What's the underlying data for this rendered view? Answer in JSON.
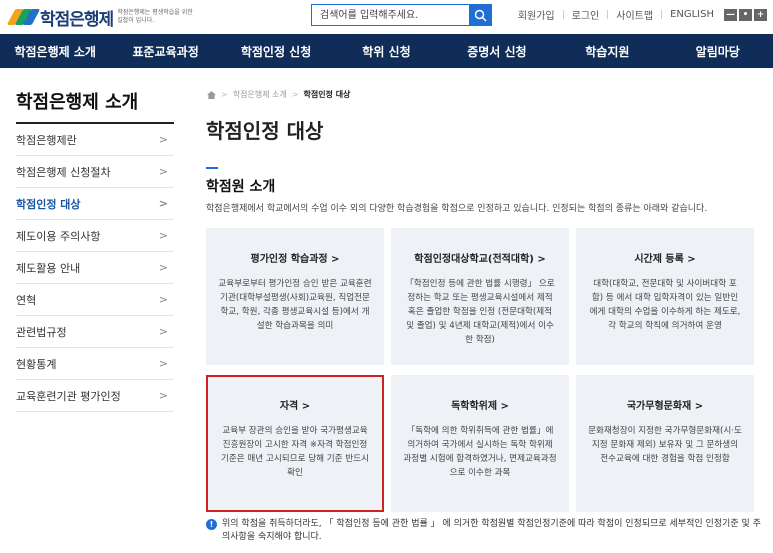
{
  "header": {
    "logo_text": "학점은행제",
    "logo_sub": "학점은행제는 평생학습을 위한 길잡이 입니다.",
    "search_placeholder": "검색어를 입력해주세요.",
    "util": [
      "회원가입",
      "로그인",
      "사이트맵",
      "ENGLISH"
    ],
    "font_buttons": [
      "—",
      "•",
      "+"
    ]
  },
  "gnb": [
    "학점은행제 소개",
    "표준교육과정",
    "학점인정 신청",
    "학위 신청",
    "증명서 신청",
    "학습지원",
    "알림마당"
  ],
  "lnb": {
    "title": "학점은행제 소개",
    "items": [
      {
        "label": "학점은행제란"
      },
      {
        "label": "학점은행제 신청절차"
      },
      {
        "label": "학점인정 대상"
      },
      {
        "label": "제도이용 주의사항"
      },
      {
        "label": "제도활용 안내"
      },
      {
        "label": "연혁"
      },
      {
        "label": "관련법규정"
      },
      {
        "label": "현황통계"
      },
      {
        "label": "교육훈련기관 평가인정"
      }
    ],
    "active_index": 2
  },
  "breadcrumb": [
    "학점은행제 소개",
    "학점인정 대상"
  ],
  "page_title": "학점인정 대상",
  "section": {
    "title": "학점원 소개",
    "desc": "학점은행제에서 학교에서의 수업 이수 외의 다양한 학습경험을 학점으로 인정하고 있습니다. 인정되는 학점의 종류는 아래와 같습니다."
  },
  "cards": [
    {
      "title": "평가인정 학습과정 >",
      "body": "교육부로부터 평가인정 승인 받은 교육훈련기관(대학부설평생(사회)교육원, 직업전문학교, 학원, 각종 평생교육시설 등)에서 개설한 학습과목을 의미"
    },
    {
      "title": "학점인정대상학교(전적대학) >",
      "body": "「학점인정 등에 관한 법률 시행령」 으로 정하는 학교 또는 평생교육시설에서 제적 혹은 졸업한 학점을 인정 (전문대학(제적 및 졸업) 및 4년제 대학교(제적)에서 이수한 학점)"
    },
    {
      "title": "시간제 등록 >",
      "body": "대학(대학교, 전문대학 및 사이버대학 포함) 등 에서 대학 입학자격이 있는 일반인에게 대학의 수업을 이수하게 하는 제도로, 각 학교의 학칙에 의거하여 운영"
    },
    {
      "title": "자격 >",
      "body": "교육부 장관의 승인을 받아 국가평생교육진흥원장이 고시한 자격 ※자격 학점인정 기준은 매년 고시되므로 당해 기준 반드시 확인"
    },
    {
      "title": "독학학위제 >",
      "body": "「독학에 의한 학위취득에 관한 법률」에 의거하여 국가에서 실시하는 독학 학위제 과정별 시험에 합격하였거나, 면제교육과정으로 이수한 과목"
    },
    {
      "title": "국가무형문화재 >",
      "body": "문화재청장이 지정한 국가무형문화재(시·도지정 문화재 제외) 보유자 및 그 문하생의 전수교육에 대한 경험을 학점 인정함"
    }
  ],
  "notice": "위의 학점을 취득하더라도, 「 학점인정 등에 관한 법률 」 에 의거한 학점원별 학점인정기준에 따라 학점이 인정되므로 세부적인 인정기준 및 주의사항을 숙지해야 합니다.",
  "colors": {
    "nav_bg": "#0f2d58",
    "accent": "#1f6ed4",
    "highlight_border": "#d11f24",
    "card_bg": "#eef1f5"
  }
}
